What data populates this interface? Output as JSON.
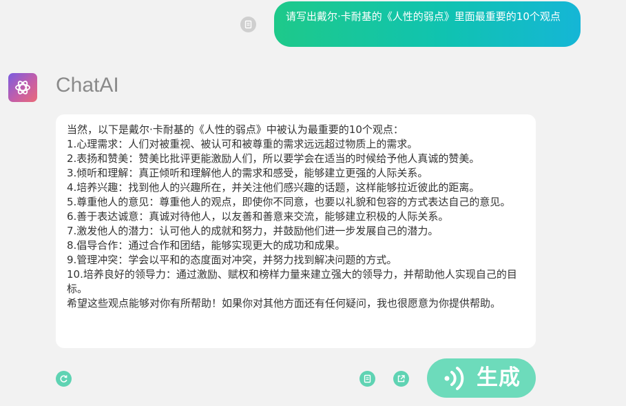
{
  "user_message": {
    "text": "请写出戴尔·卡耐基的《人性的弱点》里面最重要的10个观点"
  },
  "assistant": {
    "name": "ChatAI",
    "reply_lines": [
      "当然，以下是戴尔·卡耐基的《人性的弱点》中被认为最重要的10个观点：",
      "1.心理需求：人们对被重视、被认可和被尊重的需求远远超过物质上的需求。",
      "2.表扬和赞美：赞美比批评更能激励人们，所以要学会在适当的时候给予他人真诚的赞美。",
      "3.倾听和理解：真正倾听和理解他人的需求和感受，能够建立更强的人际关系。",
      "4.培养兴趣：找到他人的兴趣所在，并关注他们感兴趣的话题，这样能够拉近彼此的距离。",
      "5.尊重他人的意见：尊重他人的观点，即使你不同意，也要以礼貌和包容的方式表达自己的意见。",
      "6.善于表达诚意：真诚对待他人，以友善和善意来交流，能够建立积极的人际关系。",
      "7.激发他人的潜力：认可他人的成就和努力，并鼓励他们进一步发展自己的潜力。",
      "8.倡导合作：通过合作和团结，能够实现更大的成功和成果。",
      "9.管理冲突：学会以平和的态度面对冲突，并努力找到解决问题的方式。",
      "10.培养良好的领导力：通过激励、赋权和榜样力量来建立强大的领导力，并帮助他人实现自己的目标。",
      "希望这些观点能够对你有所帮助！如果你对其他方面还有任何疑问，我也很愿意为你提供帮助。"
    ]
  },
  "actions": {
    "generate_label": "生成"
  },
  "icons": {
    "copy": "copy-icon",
    "refresh": "refresh-icon",
    "share": "share-icon",
    "voice": "voice-icon",
    "avatar": "openai-logo-icon"
  },
  "colors": {
    "accent": "#5fd3b3",
    "generate_button": "#6ddbbb",
    "bubble_start": "#1ec98a",
    "bubble_end": "#15b6d6",
    "background": "#f2f2f2"
  }
}
